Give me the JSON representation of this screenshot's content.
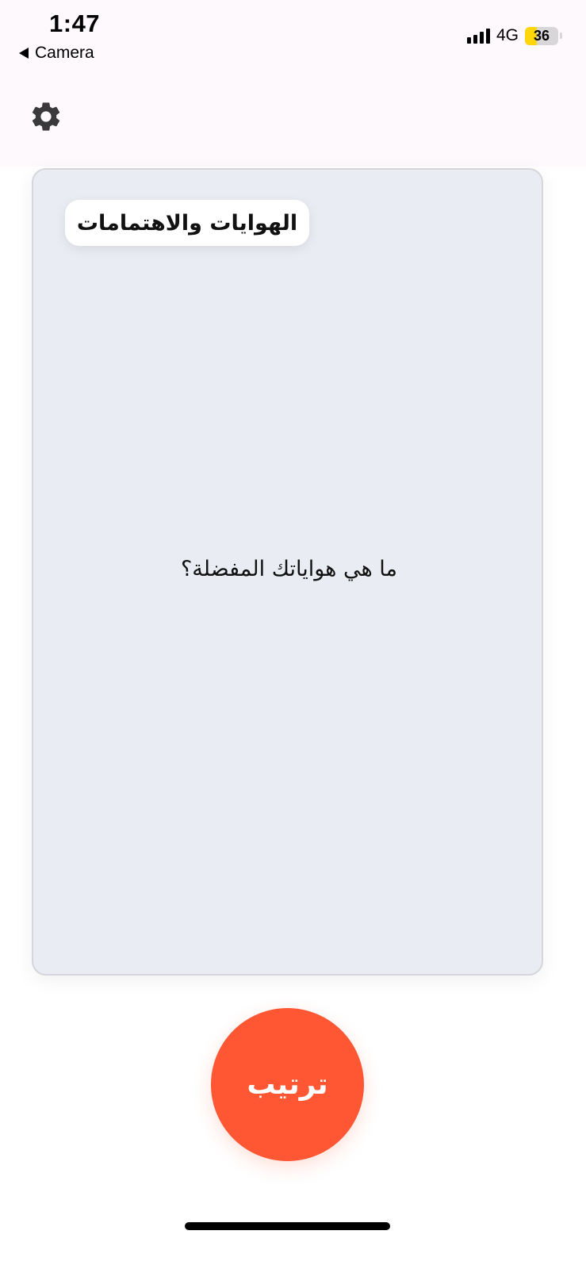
{
  "status_bar": {
    "time": "1:47",
    "back_app": "Camera",
    "network": "4G",
    "battery": "36",
    "battery_level_percent": 36,
    "battery_color": "#ffd60a"
  },
  "header": {
    "settings_icon": "gear-icon"
  },
  "card": {
    "category": "الهوايات والاهتمامات",
    "question": "ما هي هواياتك المفضلة؟",
    "background": "#e9ecf3"
  },
  "actions": {
    "shuffle_label": "ترتيب",
    "shuffle_color": "#ff5733"
  }
}
